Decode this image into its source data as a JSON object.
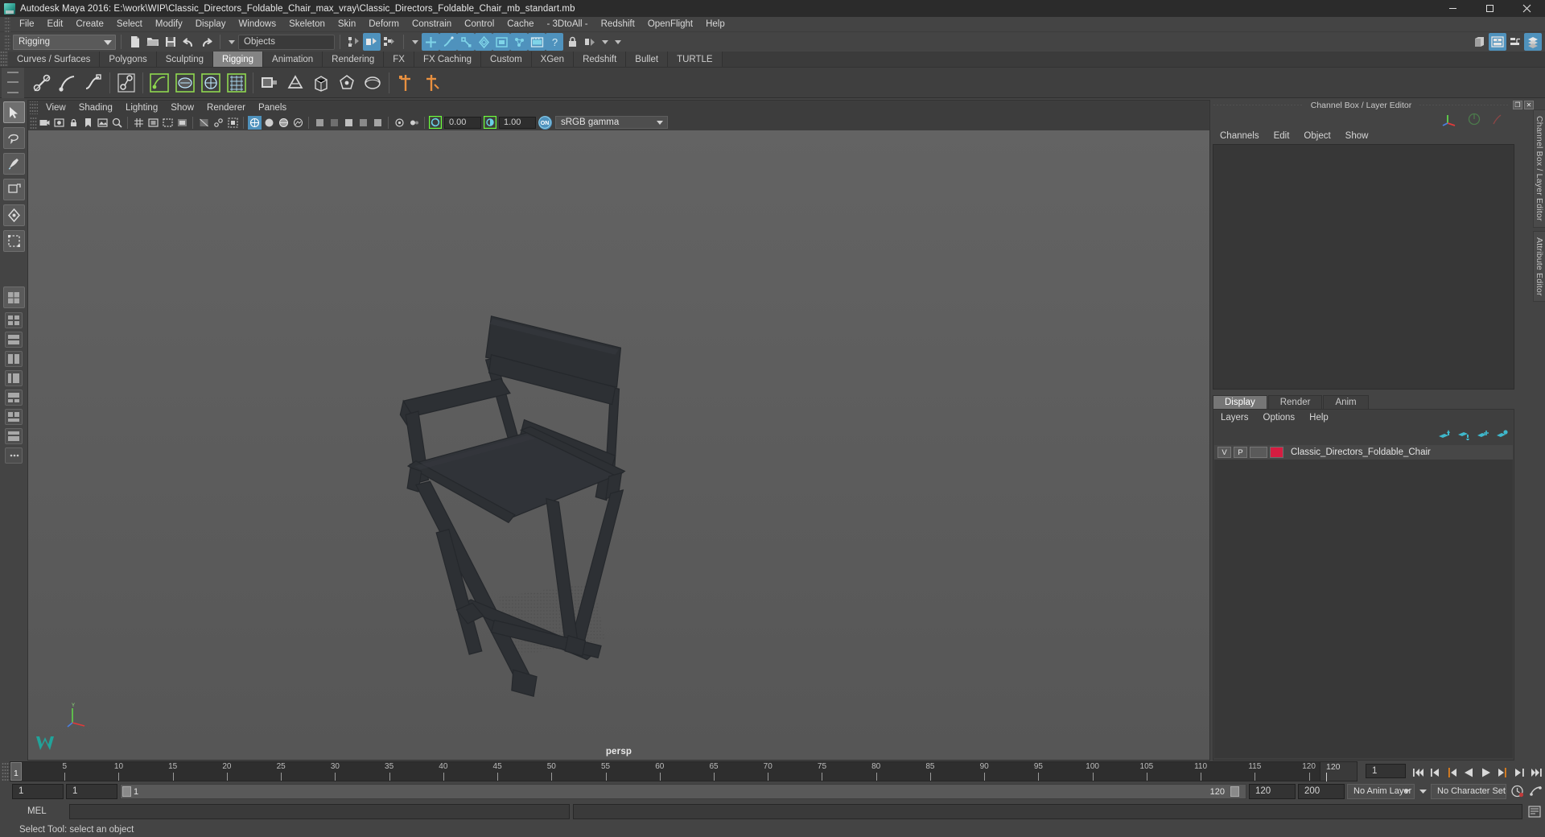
{
  "window": {
    "title": "Autodesk Maya 2016: E:\\work\\WIP\\Classic_Directors_Foldable_Chair_max_vray\\Classic_Directors_Foldable_Chair_mb_standart.mb",
    "minimize_label": "–",
    "maximize_label": "□",
    "close_label": "✕"
  },
  "menu": {
    "items": [
      "File",
      "Edit",
      "Create",
      "Select",
      "Modify",
      "Display",
      "Windows",
      "Skeleton",
      "Skin",
      "Deform",
      "Constrain",
      "Control",
      "Cache",
      "- 3DtoAll -",
      "Redshift",
      "OpenFlight",
      "Help"
    ]
  },
  "status_line": {
    "menu_set": "Rigging",
    "selection_mask": "Objects",
    "new_scene_icon": "new-scene-icon",
    "open_scene_icon": "open-scene-icon",
    "save_scene_icon": "save-scene-icon",
    "undo_icon": "undo-icon",
    "redo_icon": "redo-icon",
    "lock_icon": "lock-icon",
    "history_icon": "construction-history-icon",
    "render_icon": "render-current-frame-icon",
    "ipr_icon": "ipr-render-icon",
    "render_settings_icon": "render-settings-icon",
    "panel_toggle_icons": [
      "sidebar-toggle-icon",
      "attribute-editor-icon",
      "tool-settings-icon",
      "channel-box-icon"
    ]
  },
  "shelf": {
    "tabs": [
      "Curves / Surfaces",
      "Polygons",
      "Sculpting",
      "Rigging",
      "Animation",
      "Rendering",
      "FX",
      "FX Caching",
      "Custom",
      "XGen",
      "Redshift",
      "Bullet",
      "TURTLE"
    ],
    "active_tab": "Rigging",
    "buttons": [
      "create-joint-icon",
      "create-ik-handle-icon",
      "create-ik-spline-icon",
      "insert-joint-icon",
      "bind-skin-icon",
      "smooth-bind-icon",
      "interactive-bind-icon",
      "detach-skin-icon",
      "paint-weights-icon",
      "create-deformer-icon",
      "lattice-icon",
      "cluster-icon",
      "wrap-icon",
      "blend-shape-icon",
      "wire-tool-icon",
      "mirror-joint-icon",
      "constraint-parent-icon",
      "constraint-point-icon"
    ]
  },
  "toolbox": {
    "tools": [
      "select-tool-icon",
      "lasso-select-tool-icon",
      "paint-select-tool-icon",
      "move-tool-icon",
      "rotate-tool-icon",
      "scale-tool-icon",
      "last-tool-icon"
    ],
    "layouts": [
      "single-perspective-layout-icon",
      "four-view-layout-icon",
      "two-pane-stacked-layout-icon",
      "two-pane-side-layout-icon",
      "outliner-persp-layout-icon",
      "hypergraph-persp-layout-icon",
      "persp-graph-layout-icon",
      "three-pane-layout-icon",
      "more-layouts-icon"
    ]
  },
  "viewport": {
    "menus": [
      "View",
      "Shading",
      "Lighting",
      "Show",
      "Renderer",
      "Panels"
    ],
    "camera_label": "persp",
    "exposure_value": "0.00",
    "gamma_value": "1.00",
    "color_management": "sRGB gamma",
    "color_management_toggle": "ON",
    "gate_icons": [
      "camera-attributes-icon",
      "select-camera-icon",
      "lock-camera-icon",
      "camera-bookmark-icon",
      "image-plane-icon",
      "two-d-pan-zoom-icon",
      "grid-toggle-icon",
      "film-gate-icon",
      "resolution-gate-icon",
      "gate-mask-icon",
      "xray-toggle-icon",
      "xray-joints-icon",
      "wireframe-icon",
      "smooth-shade-icon",
      "shaded-wireframe-icon",
      "textured-icon",
      "lighting-icon",
      "shadows-icon",
      "screen-space-ao-icon",
      "motion-blur-icon",
      "multisample-icon",
      "depth-of-field-icon",
      "isolate-select-icon"
    ],
    "axis_gizmo": "axis-orientation-gizmo",
    "maya_logo": "maya-logo-icon"
  },
  "channel_box": {
    "panel_title": "Channel Box / Layer Editor",
    "float_button": "❐",
    "close_button": "✕",
    "menus": [
      "Channels",
      "Edit",
      "Object",
      "Show"
    ]
  },
  "layer_editor": {
    "tabs": [
      "Display",
      "Render",
      "Anim"
    ],
    "active_tab": "Display",
    "menus": [
      "Layers",
      "Options",
      "Help"
    ],
    "toolbar_icons": [
      "move-layer-up-icon",
      "move-layer-down-icon",
      "new-layer-icon",
      "new-layer-from-selected-icon"
    ],
    "layers": [
      {
        "visibility": "V",
        "playback": "P",
        "shading": "",
        "color": "#d61c41",
        "name": "Classic_Directors_Foldable_Chair"
      }
    ]
  },
  "side_tabs": [
    "Channel Box / Layer Editor",
    "Attribute Editor"
  ],
  "time_slider": {
    "start_visible_frame": "1",
    "tick_labels": [
      "5",
      "10",
      "15",
      "20",
      "25",
      "30",
      "35",
      "40",
      "45",
      "50",
      "55",
      "60",
      "65",
      "70",
      "75",
      "80",
      "85",
      "90",
      "95",
      "100",
      "105",
      "110",
      "115",
      "120"
    ],
    "current_frame": "1",
    "end_label": "120",
    "current_frame_field": "1",
    "playback_buttons": [
      "go-to-start-icon",
      "step-back-keyframe-icon",
      "step-back-frame-icon",
      "play-backwards-icon",
      "play-forwards-icon",
      "step-forward-frame-icon",
      "step-forward-keyframe-icon",
      "go-to-end-icon"
    ]
  },
  "range_slider": {
    "anim_start": "1",
    "range_start": "1",
    "bar_start": "1",
    "bar_end": "120",
    "range_end": "120",
    "anim_end": "200",
    "anim_layer": "No Anim Layer",
    "character_set": "No Character Set",
    "auto_key_icon": "auto-keyframe-icon",
    "anim_prefs_icon": "animation-preferences-icon"
  },
  "command_line": {
    "label": "MEL",
    "input_value": "",
    "output_value": ""
  },
  "help_line": {
    "text": "Select Tool: select an object",
    "icons": [
      "help-line-icon"
    ]
  },
  "colors": {
    "accent_blue": "#4f92bd",
    "viewport_bg": "#5c5c5c",
    "chair_dark": "#2c2f33",
    "layer_red": "#d61c41",
    "panel_bg": "#444444",
    "titlebar_bg": "#2b2b2b",
    "active_tab": "#848484"
  }
}
